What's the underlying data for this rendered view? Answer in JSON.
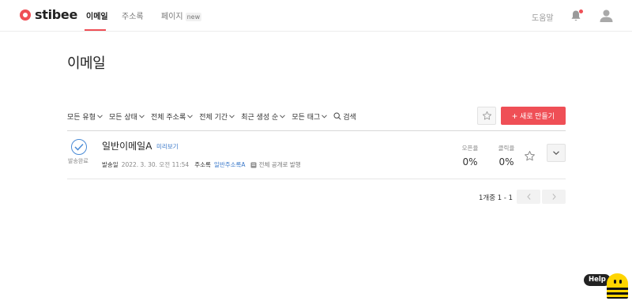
{
  "app": {
    "logo_text": "stibee",
    "brand_color": "#ef4f56",
    "link_color": "#3a78c9"
  },
  "nav": {
    "tabs": [
      {
        "label": "이메일",
        "active": true
      },
      {
        "label": "주소록",
        "active": false
      },
      {
        "label": "페이지",
        "active": false,
        "badge": "new"
      }
    ],
    "help_label": "도움말",
    "icons": [
      "bell-icon",
      "user-icon"
    ],
    "has_notification": true
  },
  "page": {
    "title": "이메일"
  },
  "filters": {
    "items": [
      "모든 유형",
      "모든 상태",
      "전체 주소록",
      "전체 기간",
      "최근 생성 순",
      "모든 태그"
    ],
    "search_label": "검색"
  },
  "actions": {
    "new_button_label": "새로 만들기"
  },
  "emails": [
    {
      "status": "발송완료",
      "title": "일반이메일A",
      "preview_label": "미리보기",
      "sent_label": "발송일",
      "sent_date": "2022. 3. 30. 오전 11:54",
      "list_label": "주소록",
      "list_name": "일반주소록A",
      "visibility": "전체 공개로 발행",
      "open_rate_label": "오픈율",
      "open_rate": "0%",
      "click_rate_label": "클릭율",
      "click_rate": "0%"
    }
  ],
  "pagination": {
    "info": "1개중 1 - 1"
  },
  "help_widget": {
    "label": "Help"
  }
}
